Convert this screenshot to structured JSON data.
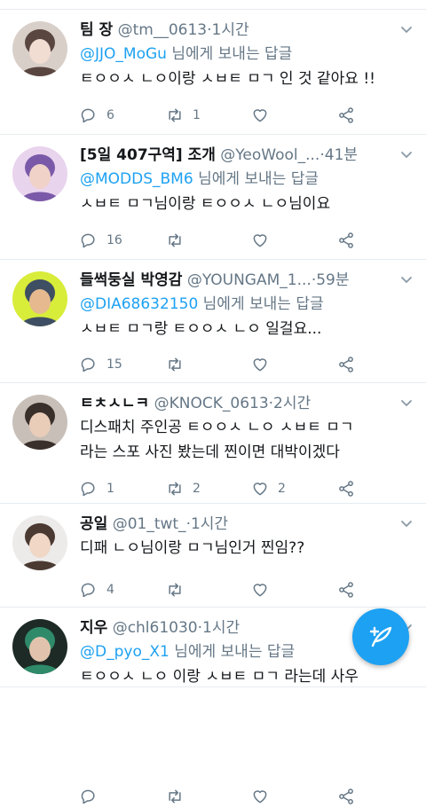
{
  "tweets": [
    {
      "name": "팀 장",
      "handle": "@tm__0613",
      "time": "1시간",
      "reply_to": "@JJO_MoGu",
      "reply_suffix": " 님에게 보내는 답글",
      "text": "ㅌㅇㅇㅅ ㄴㅇ이랑 ㅅㅂㅌ ㅁㄱ 인 것 같아요 !!",
      "replies": "6",
      "retweets": "1",
      "likes": "",
      "avatar_colors": [
        "#d9cfc9",
        "#5a4640",
        "#f1ddd2"
      ]
    },
    {
      "name": "[5일 407구역] 조개",
      "handle": "@YeoWool_...",
      "time": "41분",
      "reply_to": "@MODDS_BM6",
      "reply_suffix": " 님에게 보내는 답글",
      "text": "ㅅㅂㅌ ㅁㄱ님이랑 ㅌㅇㅇㅅ ㄴㅇ님이요",
      "replies": "16",
      "retweets": "",
      "likes": "",
      "avatar_colors": [
        "#e9d4ee",
        "#7a5aa8",
        "#f0d2c8"
      ]
    },
    {
      "name": "들썩둥실 박영감",
      "handle": "@YOUNGAM_1...",
      "time": "59분",
      "reply_to": "@DIA68632150",
      "reply_suffix": " 님에게 보내는 답글",
      "text": "ㅅㅂㅌ ㅁㄱ랑 ㅌㅇㅇㅅ ㄴㅇ 일걸요...",
      "replies": "15",
      "retweets": "",
      "likes": "",
      "avatar_colors": [
        "#d8ec3a",
        "#3e4e63",
        "#e6b98f"
      ]
    },
    {
      "name": "ㅌㅊㅅㄴㅋ",
      "handle": "@KNOCK_0613",
      "time": "2시간",
      "reply_to": "",
      "reply_suffix": "",
      "text": "디스패치 주인공 ㅌㅇㅇㅅ ㄴㅇ ㅅㅂㅌ ㅁㄱ\n라는 스포 사진 봤는데 찐이면 대박이겠다",
      "replies": "1",
      "retweets": "2",
      "likes": "2",
      "avatar_colors": [
        "#c8bfb8",
        "#3a302b",
        "#e9cdb9"
      ]
    },
    {
      "name": "공일",
      "handle": "@01_twt_",
      "time": "1시간",
      "reply_to": "",
      "reply_suffix": "",
      "text": "디패 ㄴㅇ님이랑 ㅁㄱ님인거 찐임??",
      "replies": "4",
      "retweets": "",
      "likes": "",
      "avatar_colors": [
        "#ecebea",
        "#4a3a32",
        "#f0d7c6"
      ]
    },
    {
      "name": "지우",
      "handle": "@chl61030",
      "time": "1시간",
      "reply_to": "@D_pyo_X1",
      "reply_suffix": " 님에게 보내는 답글",
      "text": "ㅌㅇㅇㅅ ㄴㅇ 이랑 ㅅㅂㅌ ㅁㄱ 라는데 사우",
      "replies": "",
      "retweets": "",
      "likes": "",
      "avatar_colors": [
        "#1d2a26",
        "#2f8a6a",
        "#e1c3ad"
      ]
    }
  ],
  "dot": "·",
  "icons": {
    "reply": "reply-icon",
    "retweet": "retweet-icon",
    "like": "heart-icon",
    "share": "share-icon",
    "caret": "chevron-down-icon",
    "compose": "compose-tweet-icon"
  },
  "colors": {
    "accent": "#1da1f2",
    "text": "#14171a",
    "muted": "#657786",
    "divider": "#e6ecf0"
  }
}
